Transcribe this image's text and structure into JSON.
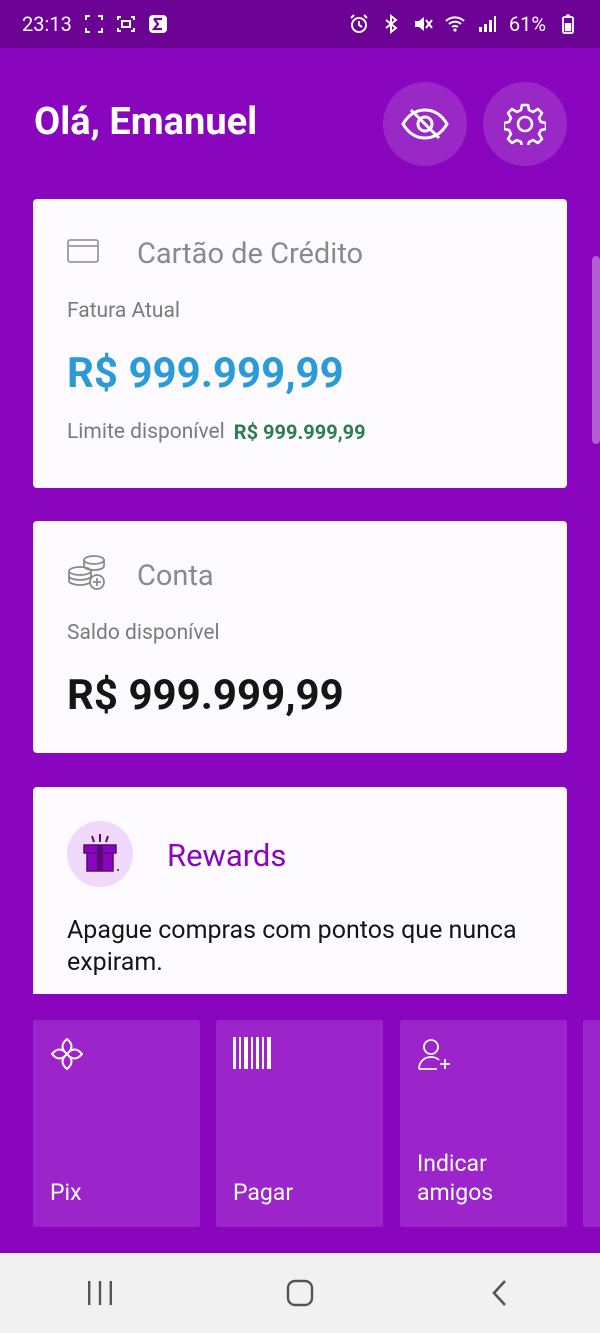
{
  "status_bar": {
    "time": "23:13",
    "battery": "61%"
  },
  "header": {
    "greeting": "Olá, Emanuel",
    "hide_values_icon": "eye-off-icon",
    "settings_icon": "gear-icon"
  },
  "credit_card": {
    "title": "Cartão de Crédito",
    "invoice_label": "Fatura Atual",
    "invoice_amount": "R$ 999.999,99",
    "limit_label": "Limite disponível",
    "limit_amount": "R$ 999.999,99"
  },
  "account": {
    "title": "Conta",
    "balance_label": "Saldo disponível",
    "balance_amount": "R$ 999.999,99"
  },
  "rewards": {
    "title": "Rewards",
    "description": "Apague compras com pontos que nunca expiram."
  },
  "shortcuts": [
    {
      "label": "Pix",
      "icon": "pix-icon"
    },
    {
      "label": "Pagar",
      "icon": "barcode-icon"
    },
    {
      "label": "Indicar amigos",
      "icon": "add-person-icon"
    }
  ],
  "colors": {
    "primary": "#8a05be",
    "status_bar": "#6c0394",
    "amount_blue": "#2a9ad8",
    "limit_green": "#2e7d4f",
    "rewards_accent": "#8a05be"
  }
}
